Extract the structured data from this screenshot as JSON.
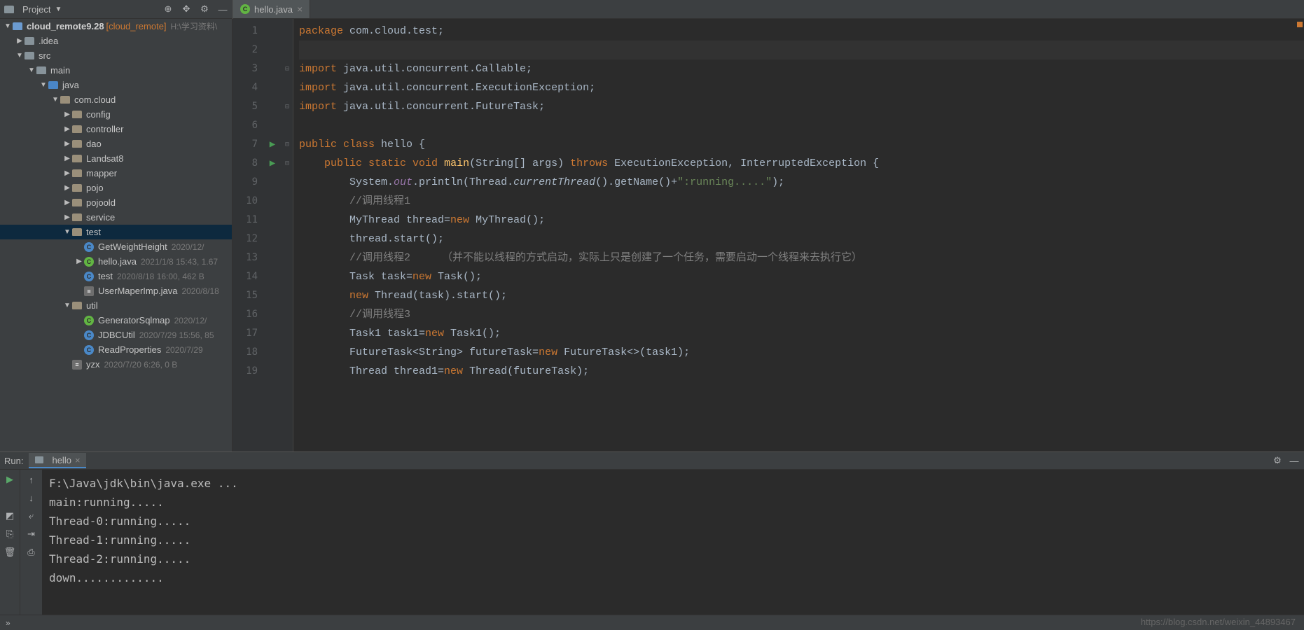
{
  "project": {
    "header_label": "Project",
    "root_name": "cloud_remote9.28",
    "root_context": "[cloud_remote]",
    "root_path": "H:\\学习资料\\",
    "tree": [
      {
        "indent": 1,
        "arrow": "right",
        "icon": "folder",
        "label": ".idea"
      },
      {
        "indent": 1,
        "arrow": "down",
        "icon": "folder",
        "label": "src"
      },
      {
        "indent": 2,
        "arrow": "down",
        "icon": "folder",
        "label": "main"
      },
      {
        "indent": 3,
        "arrow": "down",
        "icon": "src-folder",
        "label": "java"
      },
      {
        "indent": 4,
        "arrow": "down",
        "icon": "pkg",
        "label": "com.cloud"
      },
      {
        "indent": 5,
        "arrow": "right",
        "icon": "pkg",
        "label": "config"
      },
      {
        "indent": 5,
        "arrow": "right",
        "icon": "pkg",
        "label": "controller"
      },
      {
        "indent": 5,
        "arrow": "right",
        "icon": "pkg",
        "label": "dao"
      },
      {
        "indent": 5,
        "arrow": "right",
        "icon": "pkg",
        "label": "Landsat8"
      },
      {
        "indent": 5,
        "arrow": "right",
        "icon": "pkg",
        "label": "mapper"
      },
      {
        "indent": 5,
        "arrow": "right",
        "icon": "pkg",
        "label": "pojo"
      },
      {
        "indent": 5,
        "arrow": "right",
        "icon": "pkg",
        "label": "pojoold"
      },
      {
        "indent": 5,
        "arrow": "right",
        "icon": "pkg",
        "label": "service"
      },
      {
        "indent": 5,
        "arrow": "down",
        "icon": "pkg",
        "label": "test",
        "selected": true
      },
      {
        "indent": 6,
        "arrow": "",
        "icon": "class",
        "label": "GetWeightHeight",
        "meta": "2020/12/"
      },
      {
        "indent": 6,
        "arrow": "right",
        "icon": "java",
        "label": "hello.java",
        "meta": "2021/1/8 15:43, 1.67"
      },
      {
        "indent": 6,
        "arrow": "",
        "icon": "class",
        "label": "test",
        "meta": "2020/8/18 16:00, 462 B"
      },
      {
        "indent": 6,
        "arrow": "",
        "icon": "prop",
        "label": "UserMaperImp.java",
        "meta": "2020/8/18"
      },
      {
        "indent": 5,
        "arrow": "down",
        "icon": "pkg",
        "label": "util"
      },
      {
        "indent": 6,
        "arrow": "",
        "icon": "java",
        "label": "GeneratorSqlmap",
        "meta": "2020/12/"
      },
      {
        "indent": 6,
        "arrow": "",
        "icon": "class",
        "label": "JDBCUtil",
        "meta": "2020/7/29 15:56, 85"
      },
      {
        "indent": 6,
        "arrow": "",
        "icon": "class",
        "label": "ReadProperties",
        "meta": "2020/7/29"
      },
      {
        "indent": 5,
        "arrow": "",
        "icon": "prop",
        "label": "yzx",
        "meta": "2020/7/20 6:26, 0 B"
      }
    ]
  },
  "editor": {
    "tab_label": "hello.java",
    "lines": [
      {
        "n": 1,
        "html": "<span class='kw'>package</span> com.cloud.test;"
      },
      {
        "n": 2,
        "html": "",
        "hl": true
      },
      {
        "n": 3,
        "html": "<span class='kw'>import</span> java.util.concurrent.Callable;"
      },
      {
        "n": 4,
        "html": "<span class='kw'>import</span> java.util.concurrent.ExecutionException;"
      },
      {
        "n": 5,
        "html": "<span class='kw'>import</span> java.util.concurrent.FutureTask;"
      },
      {
        "n": 6,
        "html": ""
      },
      {
        "n": 7,
        "html": "<span class='kw'>public class</span> hello {",
        "run": true
      },
      {
        "n": 8,
        "html": "    <span class='kw'>public static void</span> <span class='fn'>main</span>(String[] args) <span class='kw'>throws</span> ExecutionException, InterruptedException {",
        "run": true
      },
      {
        "n": 9,
        "html": "        System.<span class='fld'>out</span>.println(Thread.<span class='ital'>currentThread</span>().getName()+<span class='str'>\":running.....\"</span>);"
      },
      {
        "n": 10,
        "html": "        <span class='com'>//调用线程1</span>"
      },
      {
        "n": 11,
        "html": "        MyThread thread=<span class='kw'>new</span> MyThread();"
      },
      {
        "n": 12,
        "html": "        thread.start();"
      },
      {
        "n": 13,
        "html": "        <span class='com'>//调用线程2     （并不能以线程的方式启动，实际上只是创建了一个任务，需要启动一个线程来去执行它）</span>"
      },
      {
        "n": 14,
        "html": "        Task task=<span class='kw'>new</span> Task();"
      },
      {
        "n": 15,
        "html": "        <span class='kw'>new</span> Thread(task).start();"
      },
      {
        "n": 16,
        "html": "        <span class='com'>//调用线程3</span>"
      },
      {
        "n": 17,
        "html": "        Task1 task1=<span class='kw'>new</span> Task1();"
      },
      {
        "n": 18,
        "html": "        FutureTask&lt;String&gt; futureTask=<span class='kw'>new</span> FutureTask&lt;&gt;(task1);"
      },
      {
        "n": 19,
        "html": "        Thread thread1=<span class='kw'>new</span> Thread(futureTask);"
      }
    ]
  },
  "run": {
    "title": "Run:",
    "tab_label": "hello",
    "output": [
      "F:\\Java\\jdk\\bin\\java.exe ...",
      "main:running.....",
      "Thread-0:running.....",
      "Thread-1:running.....",
      "Thread-2:running.....",
      "down............."
    ]
  },
  "watermark": "https://blog.csdn.net/weixin_44893467"
}
